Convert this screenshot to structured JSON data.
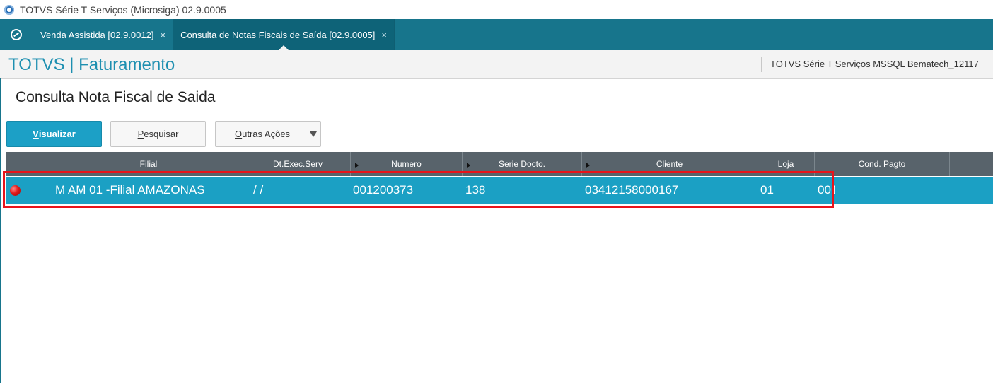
{
  "window": {
    "title": "TOTVS Série T Serviços (Microsiga) 02.9.0005"
  },
  "tabs": [
    {
      "label": "Venda Assistida [02.9.0012]",
      "close": "×"
    },
    {
      "label": "Consulta de Notas Fiscais de Saída [02.9.0005]",
      "close": "×"
    }
  ],
  "module": {
    "title": "TOTVS | Faturamento",
    "environment": "TOTVS Série T Serviços MSSQL Bematech_12117"
  },
  "page": {
    "title": "Consulta Nota Fiscal de Saida"
  },
  "toolbar": {
    "visualizar_first": "V",
    "visualizar_rest": "isualizar",
    "pesquisar_first": "P",
    "pesquisar_rest": "esquisar",
    "outras_first": "O",
    "outras_rest": "utras Ações"
  },
  "grid": {
    "columns": [
      "Filial",
      "Dt.Exec.Serv",
      "Numero",
      "Serie Docto.",
      "Cliente",
      "Loja",
      "Cond. Pagto"
    ],
    "rows": [
      {
        "status": "red",
        "filial": "M AM 01 -Filial AMAZONAS",
        "dt_exec_serv": " /  /",
        "numero": "001200373",
        "serie": "138",
        "cliente": "03412158000167",
        "loja": "01",
        "cond_pagto": "001"
      }
    ]
  },
  "colors": {
    "tabbar": "#17758c",
    "accent": "#1d8fb0",
    "primary_button": "#1ca0c6",
    "grid_header": "#58636b",
    "selected_row": "#1ba0c4",
    "highlight_box": "#e8141b"
  }
}
